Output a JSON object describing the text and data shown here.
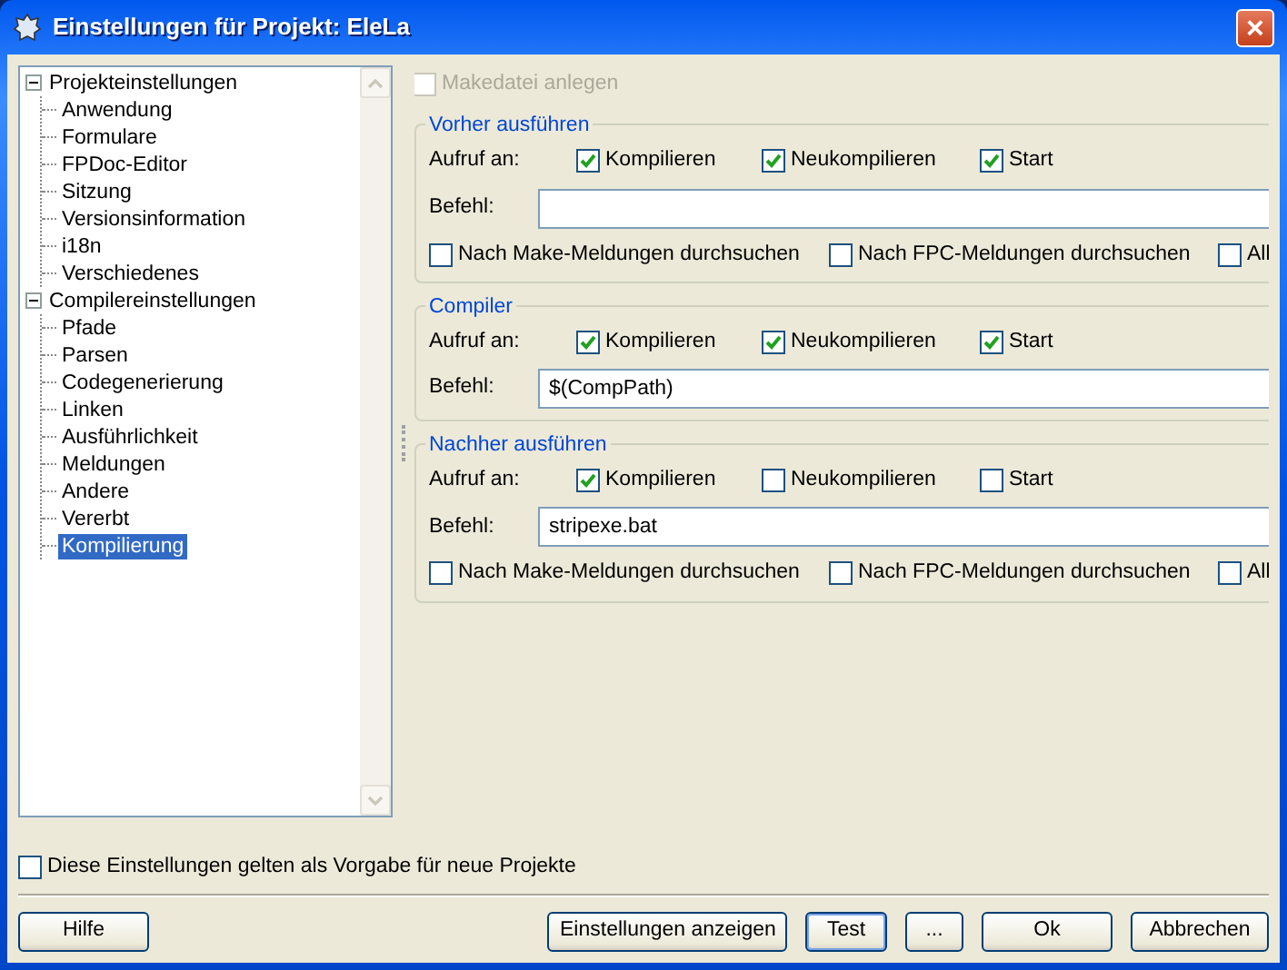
{
  "window": {
    "title": "Einstellungen für Projekt: EleLa",
    "close": "×"
  },
  "tree": [
    {
      "label": "Projekteinstellungen",
      "expanded": true,
      "selected": false,
      "children": [
        {
          "label": "Anwendung",
          "selected": false
        },
        {
          "label": "Formulare",
          "selected": false
        },
        {
          "label": "FPDoc-Editor",
          "selected": false
        },
        {
          "label": "Sitzung",
          "selected": false
        },
        {
          "label": "Versionsinformation",
          "selected": false
        },
        {
          "label": "i18n",
          "selected": false
        },
        {
          "label": "Verschiedenes",
          "selected": false
        }
      ]
    },
    {
      "label": "Compilereinstellungen",
      "expanded": true,
      "selected": false,
      "children": [
        {
          "label": "Pfade",
          "selected": false
        },
        {
          "label": "Parsen",
          "selected": false
        },
        {
          "label": "Codegenerierung",
          "selected": false
        },
        {
          "label": "Linken",
          "selected": false
        },
        {
          "label": "Ausführlichkeit",
          "selected": false
        },
        {
          "label": "Meldungen",
          "selected": false
        },
        {
          "label": "Andere",
          "selected": false
        },
        {
          "label": "Vererbt",
          "selected": false
        },
        {
          "label": "Kompilierung",
          "selected": true
        }
      ]
    }
  ],
  "make_file": {
    "label": "Makedatei anlegen",
    "checked": false,
    "disabled": true
  },
  "groups": [
    {
      "title": "Vorher ausführen",
      "call_label": "Aufruf an:",
      "call_on": [
        {
          "label": "Kompilieren",
          "checked": true
        },
        {
          "label": "Neukompilieren",
          "checked": true
        },
        {
          "label": "Start",
          "checked": true
        }
      ],
      "command_label": "Befehl:",
      "scan": [
        {
          "label": "Nach Make-Meldungen durchsuchen",
          "checked": false
        },
        {
          "label": "Nach FPC-Meldungen durchsuchen",
          "checked": false
        },
        {
          "label": "All",
          "checked": false
        }
      ]
    },
    {
      "title": "Compiler",
      "call_label": "Aufruf an:",
      "call_on": [
        {
          "label": "Kompilieren",
          "checked": true
        },
        {
          "label": "Neukompilieren",
          "checked": true
        },
        {
          "label": "Start",
          "checked": true
        }
      ],
      "command_label": "Befehl:",
      "command_value": "$(CompPath)"
    },
    {
      "title": "Nachher ausführen",
      "call_label": "Aufruf an:",
      "call_on": [
        {
          "label": "Kompilieren",
          "checked": true
        },
        {
          "label": "Neukompilieren",
          "checked": false
        },
        {
          "label": "Start",
          "checked": false
        }
      ],
      "command_label": "Befehl:",
      "command_value": "stripexe.bat",
      "scan": [
        {
          "label": "Nach Make-Meldungen durchsuchen",
          "checked": false
        },
        {
          "label": "Nach FPC-Meldungen durchsuchen",
          "checked": false
        },
        {
          "label": "All",
          "checked": false
        }
      ]
    }
  ],
  "default_option": {
    "label": "Diese Einstellungen gelten als Vorgabe für neue Projekte",
    "checked": false
  },
  "buttons": [
    {
      "label": "Hilfe",
      "kind": "left",
      "focused": false
    },
    {
      "label": "Einstellungen anzeigen",
      "kind": "right",
      "focused": false
    },
    {
      "label": "Test",
      "kind": "right",
      "focused": true
    },
    {
      "label": "...",
      "kind": "right",
      "focused": false
    },
    {
      "label": "Ok",
      "kind": "right",
      "focused": false
    },
    {
      "label": "Abbrechen",
      "kind": "right",
      "focused": false
    }
  ]
}
